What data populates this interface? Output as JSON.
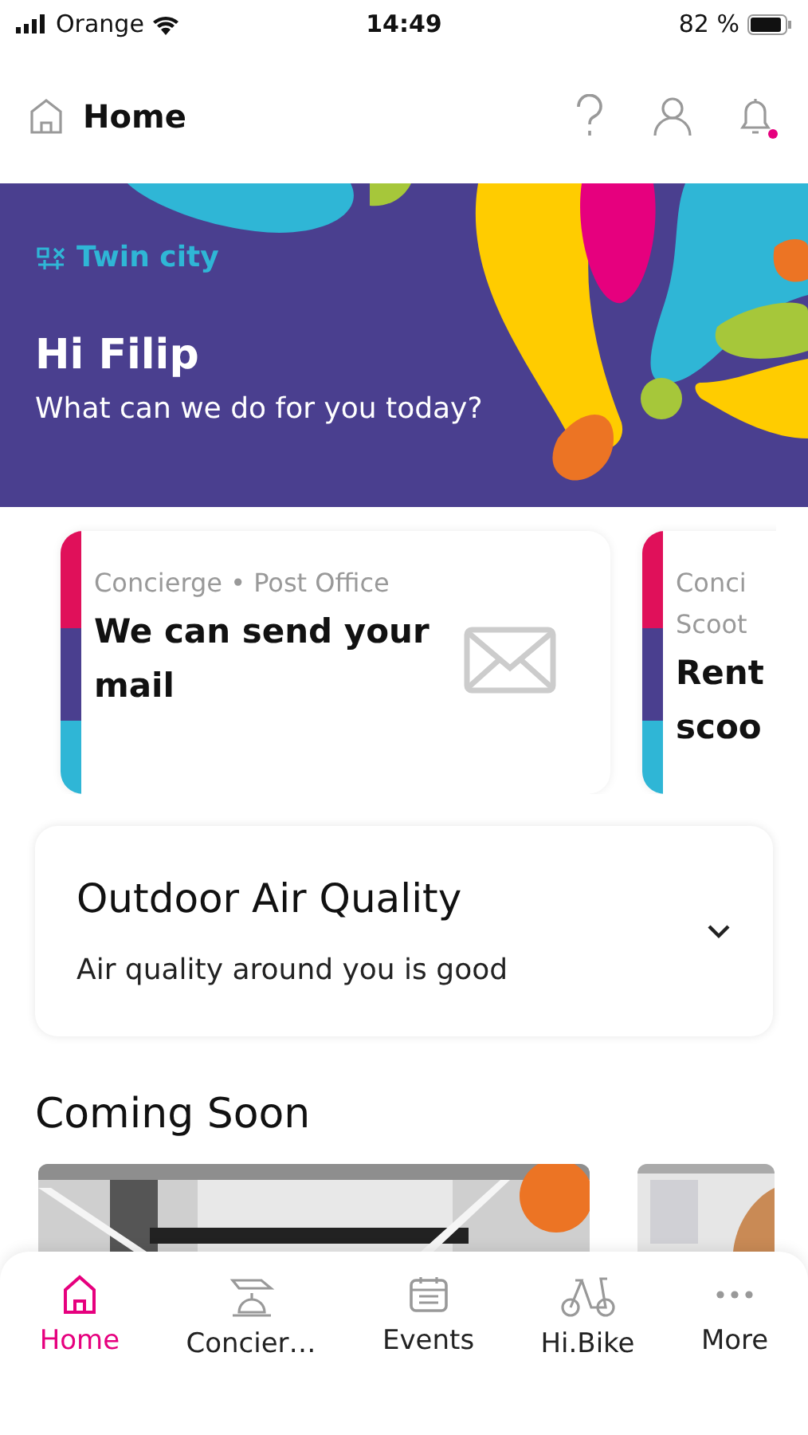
{
  "status_bar": {
    "carrier": "Orange",
    "time": "14:49",
    "battery": "82 %"
  },
  "header": {
    "title": "Home",
    "notification_dot": true
  },
  "banner": {
    "brand": "Twin city",
    "greeting": "Hi Filip",
    "subtitle": "What can we do for you today?"
  },
  "cards": [
    {
      "category": "Concierge • Post Office",
      "title": "We can send your mail"
    },
    {
      "category": "Conci",
      "category_2": "Scoot",
      "title": "Rent",
      "title_2": "scoo"
    }
  ],
  "air_quality": {
    "title": "Outdoor Air Quality",
    "text": "Air quality around you is good",
    "expanded": false
  },
  "coming_soon": {
    "title": "Coming Soon"
  },
  "tab_bar": [
    {
      "label": "Home",
      "selected": true
    },
    {
      "label": "Concier…",
      "selected": false
    },
    {
      "label": "Events",
      "selected": false
    },
    {
      "label": "Hi.Bike",
      "selected": false
    },
    {
      "label": "More",
      "selected": false
    }
  ]
}
